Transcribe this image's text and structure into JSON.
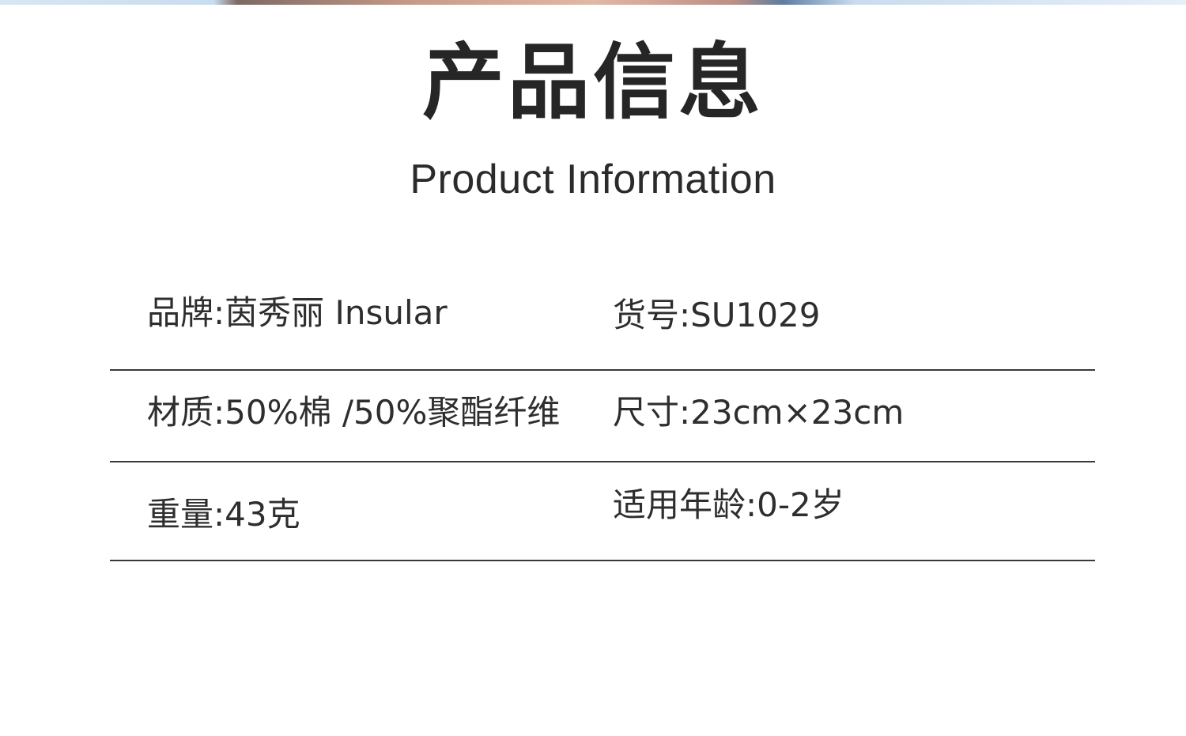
{
  "header": {
    "title_cn": "产品信息",
    "title_en": "Product Information"
  },
  "info": {
    "brand": "品牌:茵秀丽 Insular",
    "item_no": "货号:SU1029",
    "material": "材质:50%棉 /50%聚酯纤维",
    "size": "尺寸:23cm×23cm",
    "weight": "重量:43克",
    "age": "适用年龄:0-2岁"
  }
}
